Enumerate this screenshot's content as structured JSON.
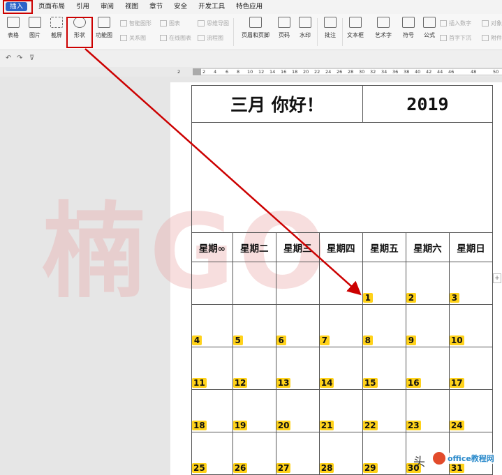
{
  "menu": {
    "tabs": [
      "插入",
      "页面布局",
      "引用",
      "审阅",
      "视图",
      "章节",
      "安全",
      "开发工具",
      "特色应用"
    ]
  },
  "ribbon": {
    "table": "表格",
    "picture": "图片",
    "screenshot": "截屏",
    "shape": "形状",
    "function_chart": "功能图",
    "smart_shape": "智能图形",
    "chart": "图表",
    "mind_map": "思维导图",
    "relation_chart": "关系图",
    "online_chart": "在线图表",
    "flowchart": "流程图",
    "header_footer": "页眉和页脚",
    "page_number": "页码",
    "watermark": "水印",
    "comment": "批注",
    "textbox": "文本框",
    "word_art": "艺术字",
    "symbol": "符号",
    "formula": "公式",
    "insert_number": "插入数字",
    "first_letter_sink": "首字下沉",
    "object": "对象",
    "attachment": "附件"
  },
  "ruler": {
    "marks": [
      "2",
      "2",
      "4",
      "6",
      "8",
      "10",
      "12",
      "14",
      "16",
      "18",
      "20",
      "22",
      "24",
      "26",
      "28",
      "30",
      "32",
      "34",
      "36",
      "38",
      "40",
      "42",
      "44",
      "46",
      "48",
      "50"
    ]
  },
  "calendar": {
    "title": "三月 你好！",
    "year": "2019",
    "weekdays": [
      "星期∞",
      "星期二",
      "星期三",
      "星期四",
      "星期五",
      "星期六",
      "星期日"
    ],
    "weeks": [
      [
        "",
        "",
        "",
        "",
        "1",
        "2",
        "3"
      ],
      [
        "4",
        "5",
        "6",
        "7",
        "8",
        "9",
        "10"
      ],
      [
        "11",
        "12",
        "13",
        "14",
        "15",
        "16",
        "17"
      ],
      [
        "18",
        "19",
        "20",
        "21",
        "22",
        "23",
        "24"
      ],
      [
        "25",
        "26",
        "27",
        "28",
        "29",
        "30",
        "31"
      ]
    ]
  },
  "watermark_text": "楠GO",
  "brand": "头",
  "site": "office教程网",
  "colors": {
    "accent": "#2b63c9",
    "highlight_box": "#cc0000",
    "date_badge": "#ffd21a"
  }
}
